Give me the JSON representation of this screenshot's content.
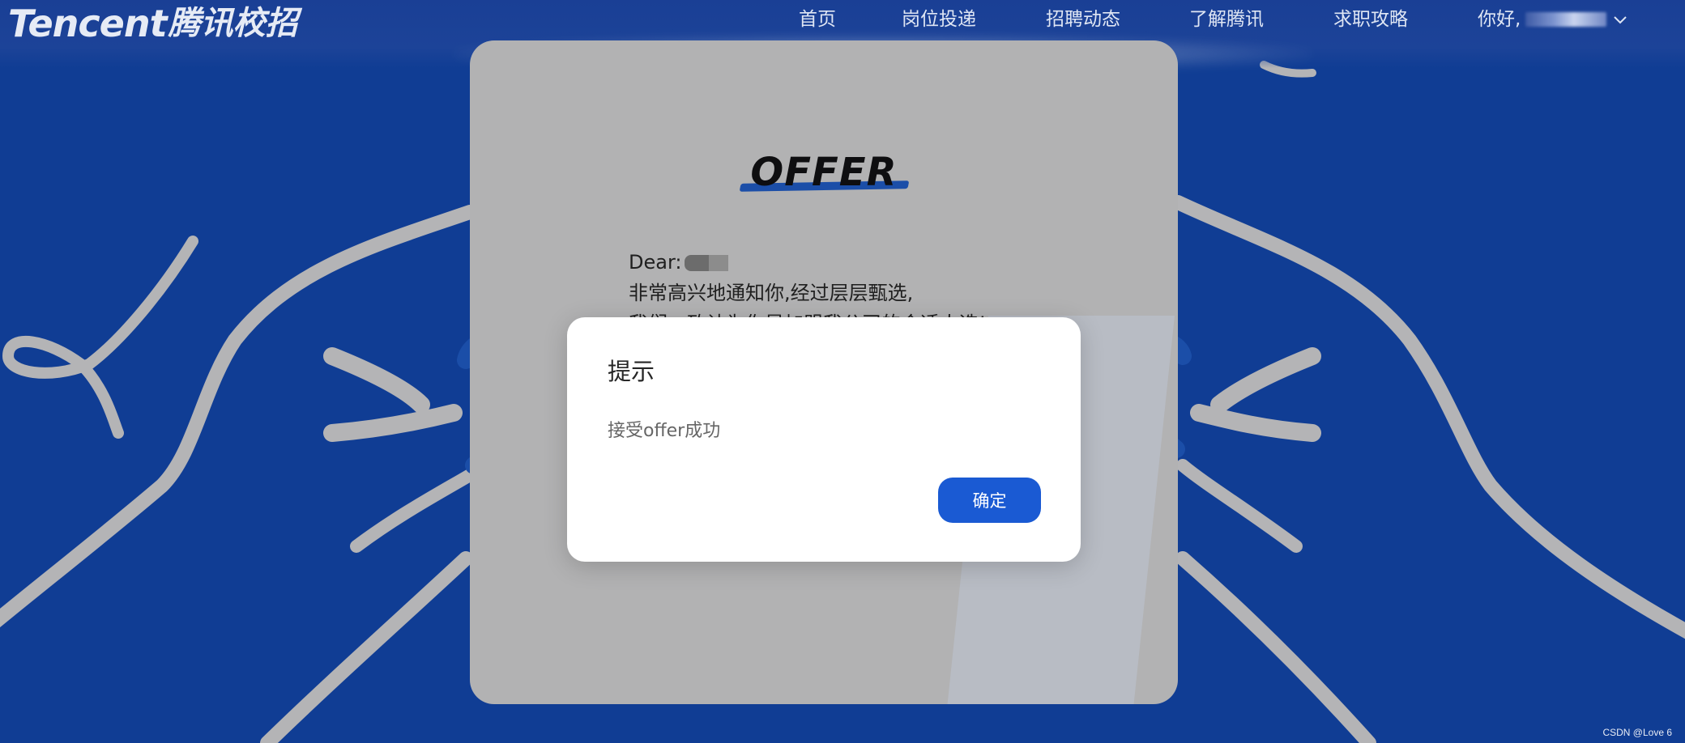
{
  "header": {
    "logo_en": "Tencent",
    "logo_cn": "腾讯校招",
    "nav": [
      {
        "label": "首页"
      },
      {
        "label": "岗位投递"
      },
      {
        "label": "招聘动态"
      },
      {
        "label": "了解腾讯"
      },
      {
        "label": "求职攻略"
      }
    ],
    "greeting": "你好,",
    "greeting_icon": "chevron-down-icon"
  },
  "card": {
    "title": "OFFER",
    "salutation": "Dear:",
    "line1": "非常高兴地通知你,经过层层甄选,",
    "line2": "我们一致认为你是加盟我公司的合适人选!"
  },
  "modal": {
    "title": "提示",
    "message": "接受offer成功",
    "confirm": "确定"
  },
  "watermark": "CSDN @Love 6",
  "colors": {
    "background": "#103d94",
    "accent": "#1a5ad3",
    "card": "#b2b2b3",
    "line_art": "#b4b4b6"
  }
}
